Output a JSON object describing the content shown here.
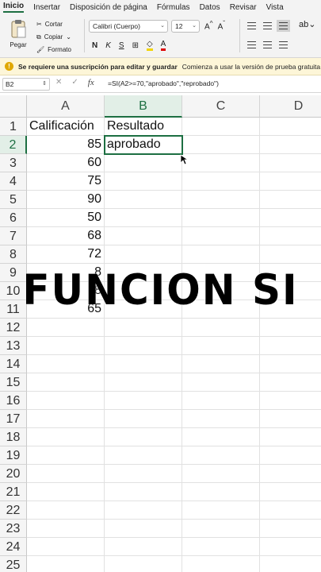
{
  "ribbon_tabs": [
    "Inicio",
    "Insertar",
    "Disposición de página",
    "Fórmulas",
    "Datos",
    "Revisar",
    "Vista"
  ],
  "ribbon": {
    "paste_label": "Pegar",
    "cut_label": "Cortar",
    "copy_label": "Copiar",
    "format_label": "Formato",
    "font_name": "Calibri (Cuerpo)",
    "font_size": "12",
    "bold": "N",
    "italic": "K",
    "underline": "S",
    "strike": "abc"
  },
  "banner": {
    "message": "Se requiere una suscripción para editar y guardar",
    "hint": "Comienza a usar la versión de prueba gratuita"
  },
  "formula_bar": {
    "cell_ref": "B2",
    "formula": "=SI(A2>=70,\"aprobado\",\"reprobado\")"
  },
  "columns": [
    "A",
    "B",
    "C",
    "D"
  ],
  "rows": [
    "1",
    "2",
    "3",
    "4",
    "5",
    "6",
    "7",
    "8",
    "9",
    "10",
    "11",
    "12",
    "13",
    "14",
    "15",
    "16",
    "17",
    "18",
    "19",
    "20",
    "21",
    "22",
    "23",
    "24",
    "25"
  ],
  "cells": {
    "A1": "Calificación",
    "B1": "Resultado",
    "A2": "85",
    "B2": "aprobado",
    "A3": "60",
    "A4": "75",
    "A5": "90",
    "A6": "50",
    "A7": "68",
    "A8": "72",
    "A9": "8",
    "A10": "8",
    "A11": "65"
  },
  "overlay_text": "FUNCION  SI",
  "colors": {
    "accent": "#1d6f42",
    "banner_bg": "#fdf6d8"
  }
}
